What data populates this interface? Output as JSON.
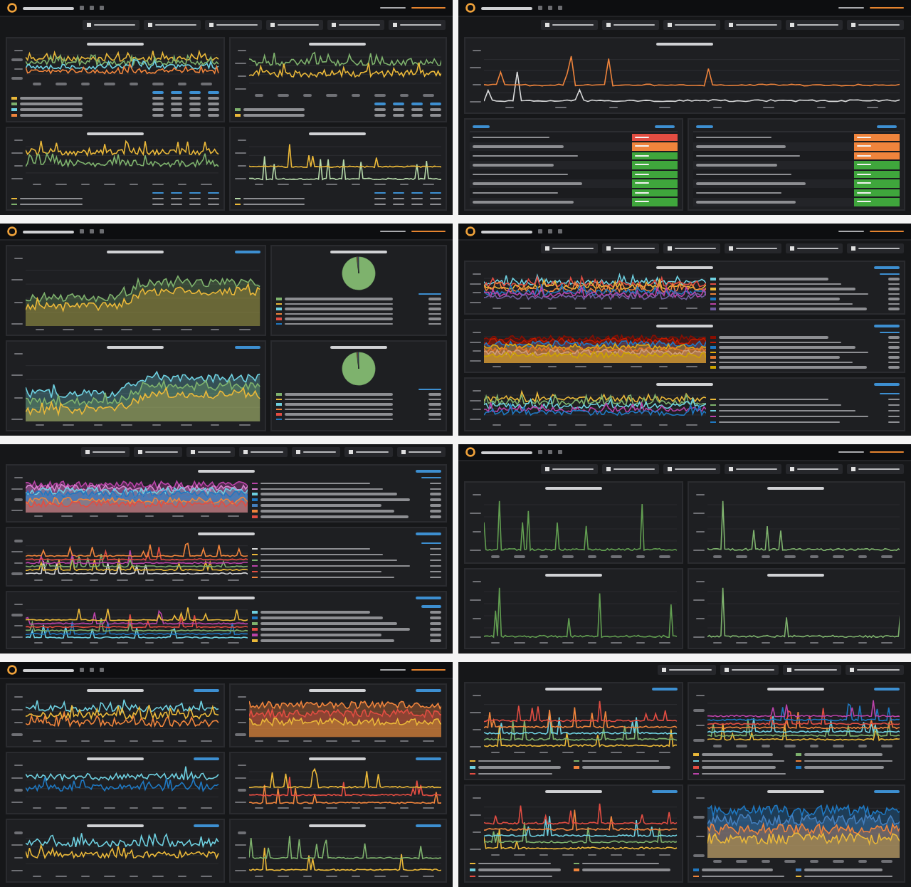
{
  "dashboards": [
    {
      "navbar": true,
      "filters": [
        {
          "checked": true
        },
        {
          "checked": true
        },
        {
          "checked": true
        },
        {
          "checked": true
        },
        {
          "checked": true
        },
        {
          "checked": true
        }
      ],
      "rows": [
        [
          {
            "kind": "line",
            "legend_table": [
              {
                "color": "#eab839"
              },
              {
                "color": "#7eb26d"
              },
              {
                "color": "#6ed0e0"
              },
              {
                "color": "#ef843c"
              }
            ]
          },
          {
            "kind": "line",
            "legend_table": [
              {
                "color": "#7eb26d"
              },
              {
                "color": "#eab839"
              }
            ]
          }
        ],
        [
          {
            "kind": "line",
            "legend_table": [
              {
                "color": "#eab839"
              },
              {
                "color": "#7eb26d"
              }
            ]
          },
          {
            "kind": "spikes",
            "legend_table": [
              {
                "color": "#b7dbab"
              },
              {
                "color": "#eab839"
              }
            ]
          }
        ]
      ]
    },
    {
      "navbar": true,
      "filters": [
        {
          "checked": true
        },
        {
          "checked": true
        },
        {
          "checked": true
        },
        {
          "checked": true
        },
        {
          "checked": true
        },
        {
          "checked": true
        }
      ],
      "rows": [
        [
          {
            "kind": "spikes",
            "series": [
              {
                "color": "#d8d9da"
              },
              {
                "color": "#ef843c"
              }
            ]
          }
        ],
        [
          {
            "kind": "table",
            "rows": [
              {
                "color": "#e24d42"
              },
              {
                "color": "#ef843c"
              },
              {
                "color": "#3fa63c"
              },
              {
                "color": "#3fa63c"
              },
              {
                "color": "#3fa63c"
              },
              {
                "color": "#3fa63c"
              },
              {
                "color": "#3fa63c"
              },
              {
                "color": "#3fa63c"
              }
            ]
          },
          {
            "kind": "table",
            "rows": [
              {
                "color": "#ef843c"
              },
              {
                "color": "#ef843c"
              },
              {
                "color": "#ef843c"
              },
              {
                "color": "#3fa63c"
              },
              {
                "color": "#3fa63c"
              },
              {
                "color": "#3fa63c"
              },
              {
                "color": "#3fa63c"
              },
              {
                "color": "#3fa63c"
              }
            ]
          }
        ]
      ]
    },
    {
      "navbar": true,
      "rows": [
        [
          {
            "kind": "area",
            "zoom_link": true,
            "series": [
              {
                "color": "#7eb26d"
              },
              {
                "color": "#eab839"
              }
            ]
          },
          {
            "kind": "pie",
            "legend": [
              {
                "color": "#7eb26d"
              },
              {
                "color": "#eab839"
              },
              {
                "color": "#6ed0e0"
              },
              {
                "color": "#ef843c"
              },
              {
                "color": "#e24d42"
              },
              {
                "color": "#1f78c1"
              }
            ]
          }
        ],
        [
          {
            "kind": "area",
            "zoom_link": true,
            "series": [
              {
                "color": "#6ed0e0"
              },
              {
                "color": "#7eb26d"
              },
              {
                "color": "#eab839"
              }
            ]
          },
          {
            "kind": "pie",
            "legend": [
              {
                "color": "#7eb26d"
              },
              {
                "color": "#eab839"
              },
              {
                "color": "#6ed0e0"
              },
              {
                "color": "#ef843c"
              },
              {
                "color": "#e24d42"
              },
              {
                "color": "#1f78c1"
              }
            ]
          }
        ]
      ]
    },
    {
      "navbar": true,
      "filters": [
        {
          "checked": true
        },
        {
          "checked": true
        },
        {
          "checked": true
        },
        {
          "checked": true
        },
        {
          "checked": true
        },
        {
          "checked": true
        }
      ],
      "rows": [
        [
          {
            "kind": "line",
            "zoom_link": true,
            "legend": [
              {
                "color": "#6ed0e0"
              },
              {
                "color": "#e24d42"
              },
              {
                "color": "#eab839"
              },
              {
                "color": "#ef843c"
              },
              {
                "color": "#1f78c1"
              },
              {
                "color": "#ba43a9"
              },
              {
                "color": "#705da0"
              }
            ]
          }
        ],
        [
          {
            "kind": "band",
            "zoom_link": true,
            "legend": [
              {
                "color": "#890f02"
              },
              {
                "color": "#bf1b00"
              },
              {
                "color": "#1f78c1"
              },
              {
                "color": "#e5ac0e"
              },
              {
                "color": "#e0752d"
              },
              {
                "color": "#ce9f7a"
              },
              {
                "color": "#cca300"
              }
            ]
          }
        ],
        [
          {
            "kind": "line",
            "zoom_link": true,
            "legend": [
              {
                "color": "#eab839"
              },
              {
                "color": "#7eb26d"
              },
              {
                "color": "#6ed0e0"
              },
              {
                "color": "#ba43a9"
              },
              {
                "color": "#1f78c1"
              }
            ]
          }
        ]
      ]
    },
    {
      "filters": [
        {
          "checked": true
        },
        {
          "checked": true
        },
        {
          "checked": true
        },
        {
          "checked": true
        },
        {
          "checked": true
        },
        {
          "checked": true
        },
        {
          "checked": true
        }
      ],
      "rows": [
        [
          {
            "kind": "band",
            "zoom_link": true,
            "legend": [
              {
                "color": "#ba43a9"
              },
              {
                "color": "#d683ce"
              },
              {
                "color": "#6ed0e0"
              },
              {
                "color": "#1f78c1"
              },
              {
                "color": "#447ebc"
              },
              {
                "color": "#ef843c"
              },
              {
                "color": "#e24d42"
              }
            ]
          }
        ],
        [
          {
            "kind": "spikes",
            "zoom_link": true,
            "legend": [
              {
                "color": "#d8d9da"
              },
              {
                "color": "#eab839"
              },
              {
                "color": "#7eb26d"
              },
              {
                "color": "#ba43a9"
              },
              {
                "color": "#e24d42"
              },
              {
                "color": "#ef843c"
              }
            ]
          }
        ],
        [
          {
            "kind": "spikes",
            "zoom_link": true,
            "legend": [
              {
                "color": "#6ed0e0"
              },
              {
                "color": "#1f78c1"
              },
              {
                "color": "#7eb26d"
              },
              {
                "color": "#e24d42"
              },
              {
                "color": "#ba43a9"
              },
              {
                "color": "#eab839"
              }
            ]
          }
        ]
      ]
    },
    {
      "navbar": true,
      "filters": [
        {
          "checked": true
        },
        {
          "checked": true
        },
        {
          "checked": true
        },
        {
          "checked": true
        },
        {
          "checked": true
        },
        {
          "checked": true
        }
      ],
      "rows": [
        [
          {
            "kind": "spikes",
            "series": [
              {
                "color": "#629e51"
              }
            ]
          },
          {
            "kind": "spikes",
            "series": [
              {
                "color": "#7eb26d"
              }
            ]
          }
        ],
        [
          {
            "kind": "spikes",
            "series": [
              {
                "color": "#629e51"
              }
            ]
          },
          {
            "kind": "spikes",
            "series": [
              {
                "color": "#7eb26d"
              }
            ]
          }
        ]
      ]
    },
    {
      "navbar": true,
      "rows": [
        [
          {
            "kind": "line",
            "zoom_link": true,
            "series": [
              {
                "color": "#6ed0e0"
              },
              {
                "color": "#eab839"
              },
              {
                "color": "#ef843c"
              }
            ]
          },
          {
            "kind": "band",
            "zoom_link": true,
            "series": [
              {
                "color": "#ef843c"
              },
              {
                "color": "#e24d42"
              },
              {
                "color": "#eab839"
              }
            ]
          }
        ],
        [
          {
            "kind": "line",
            "zoom_link": true,
            "series": [
              {
                "color": "#6ed0e0"
              },
              {
                "color": "#1f78c1"
              }
            ]
          },
          {
            "kind": "spikes",
            "zoom_link": true,
            "series": [
              {
                "color": "#ef843c"
              },
              {
                "color": "#e24d42"
              },
              {
                "color": "#eab839"
              }
            ]
          }
        ],
        [
          {
            "kind": "line",
            "zoom_link": true,
            "series": [
              {
                "color": "#6ed0e0"
              },
              {
                "color": "#eab839"
              }
            ]
          },
          {
            "kind": "spikes",
            "zoom_link": true,
            "series": [
              {
                "color": "#eab839"
              },
              {
                "color": "#7eb26d"
              }
            ]
          }
        ]
      ]
    },
    {
      "filters": [
        {
          "checked": true
        },
        {
          "checked": true
        },
        {
          "checked": true
        },
        {
          "checked": true
        }
      ],
      "rows": [
        [
          {
            "kind": "spikes",
            "zoom_link": true,
            "legend": [
              {
                "color": "#eab839"
              },
              {
                "color": "#7eb26d"
              },
              {
                "color": "#6ed0e0"
              },
              {
                "color": "#ef843c"
              },
              {
                "color": "#e24d42"
              }
            ]
          },
          {
            "kind": "spikes",
            "zoom_link": true,
            "legend": [
              {
                "color": "#eab839"
              },
              {
                "color": "#7eb26d"
              },
              {
                "color": "#6ed0e0"
              },
              {
                "color": "#ef843c"
              },
              {
                "color": "#e24d42"
              },
              {
                "color": "#1f78c1"
              },
              {
                "color": "#ba43a9"
              }
            ]
          }
        ],
        [
          {
            "kind": "spikes",
            "zoom_link": true,
            "legend": [
              {
                "color": "#eab839"
              },
              {
                "color": "#7eb26d"
              },
              {
                "color": "#6ed0e0"
              },
              {
                "color": "#ef843c"
              },
              {
                "color": "#e24d42"
              }
            ]
          },
          {
            "kind": "band",
            "zoom_link": true,
            "legend": [
              {
                "color": "#1f78c1"
              },
              {
                "color": "#447ebc"
              },
              {
                "color": "#ef843c"
              },
              {
                "color": "#eab839"
              }
            ]
          }
        ]
      ]
    }
  ]
}
